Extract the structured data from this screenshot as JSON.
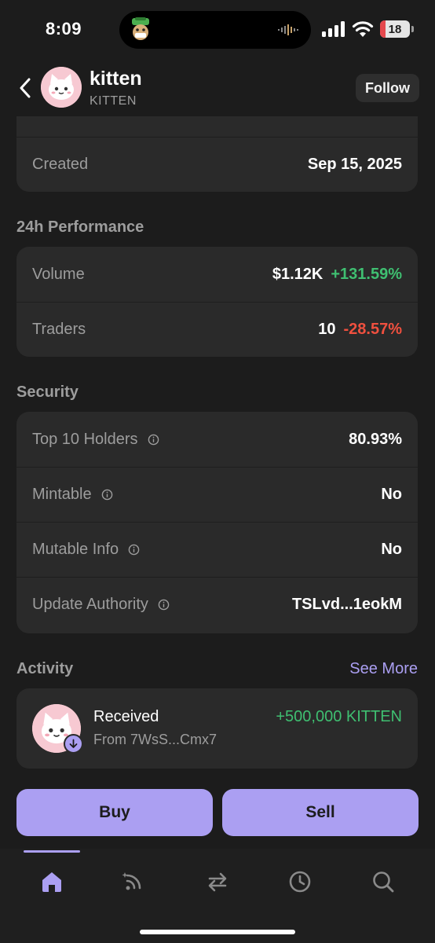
{
  "status_bar": {
    "time": "8:09",
    "battery": "18"
  },
  "header": {
    "token_name": "kitten",
    "token_symbol": "KITTEN",
    "follow_label": "Follow"
  },
  "info": {
    "created_label": "Created",
    "created_value": "Sep 15, 2025"
  },
  "performance": {
    "title": "24h Performance",
    "rows": [
      {
        "label": "Volume",
        "value": "$1.12K",
        "change": "+131.59%"
      },
      {
        "label": "Traders",
        "value": "10",
        "change": "-28.57%"
      }
    ]
  },
  "security": {
    "title": "Security",
    "rows": [
      {
        "label": "Top 10 Holders",
        "value": "80.93%"
      },
      {
        "label": "Mintable",
        "value": "No"
      },
      {
        "label": "Mutable Info",
        "value": "No"
      },
      {
        "label": "Update Authority",
        "value": "TSLvd...1eokM"
      }
    ]
  },
  "activity": {
    "title": "Activity",
    "see_more": "See More",
    "items": [
      {
        "title": "Received",
        "from": "From 7WsS...Cmx7",
        "amount": "+500,000 KITTEN"
      }
    ]
  },
  "actions": {
    "buy_label": "Buy",
    "sell_label": "Sell"
  },
  "tabbar": {
    "items": [
      {
        "icon": "home-icon",
        "active": true
      },
      {
        "icon": "feed-icon",
        "active": false
      },
      {
        "icon": "swap-icon",
        "active": false
      },
      {
        "icon": "clock-icon",
        "active": false
      },
      {
        "icon": "search-icon",
        "active": false
      }
    ]
  },
  "colors": {
    "accent": "#ab9ff2",
    "positive": "#3fbf71",
    "negative": "#f0503f",
    "card": "#2a2a2a",
    "background": "#1c1c1c"
  }
}
